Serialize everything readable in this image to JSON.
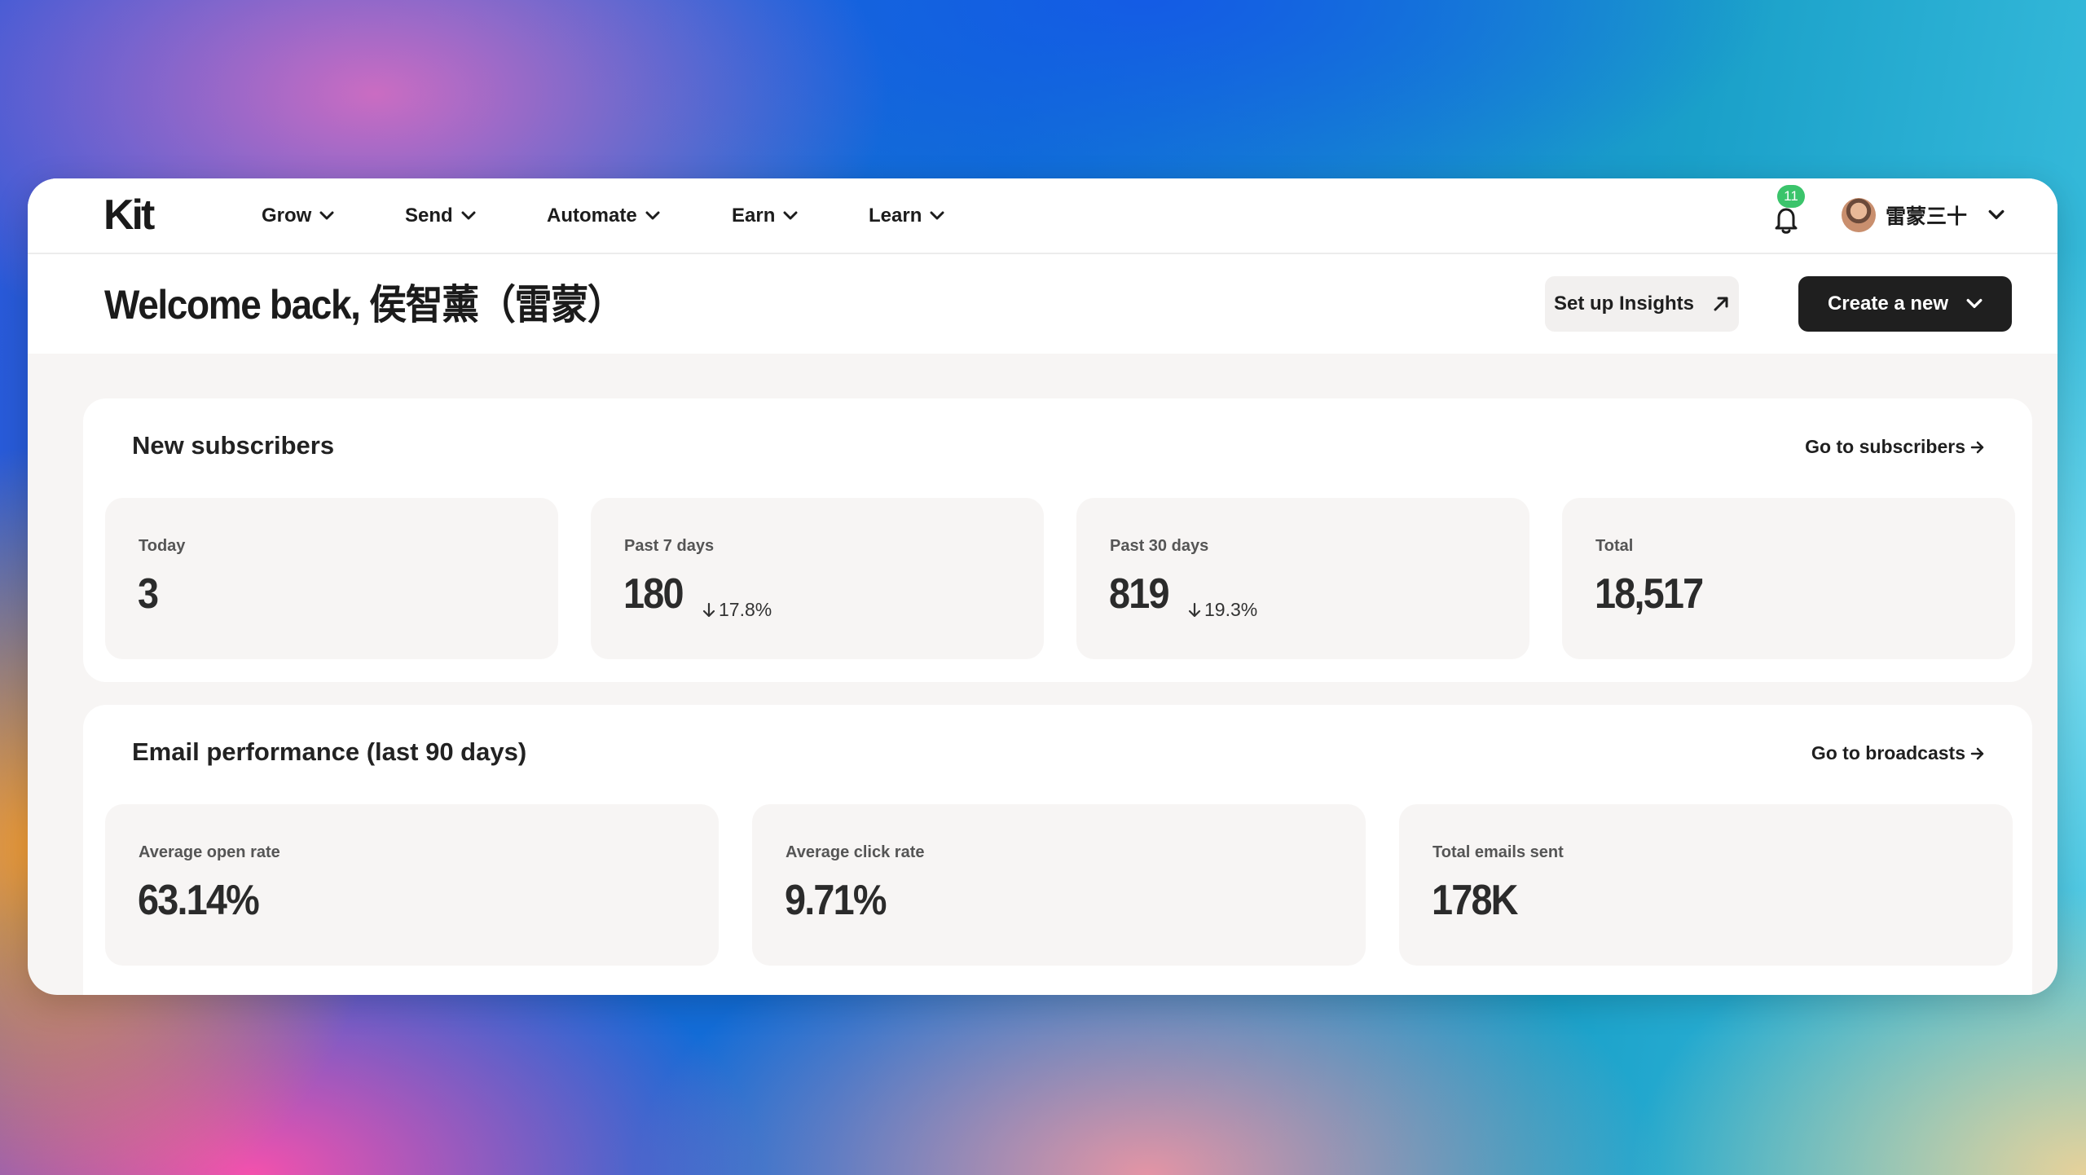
{
  "app": {
    "logo_text": "Kit"
  },
  "nav": {
    "items": [
      {
        "label": "Grow"
      },
      {
        "label": "Send"
      },
      {
        "label": "Automate"
      },
      {
        "label": "Earn"
      },
      {
        "label": "Learn"
      }
    ]
  },
  "notifications": {
    "count": "11",
    "icon": "bell-icon",
    "badge_color": "#3bc46b"
  },
  "user": {
    "name": "雷蒙三十",
    "icon": "chevron-down-icon"
  },
  "header": {
    "title": "Welcome back, 侯智薰（雷蒙）",
    "insights_button": "Set up Insights",
    "create_button": "Create a new"
  },
  "subscribers": {
    "title": "New subscribers",
    "link": "Go to subscribers",
    "stats": [
      {
        "label": "Today",
        "value": "3",
        "change": ""
      },
      {
        "label": "Past 7 days",
        "value": "180",
        "change": "17.8%"
      },
      {
        "label": "Past 30 days",
        "value": "819",
        "change": "19.3%"
      },
      {
        "label": "Total",
        "value": "18,517",
        "change": ""
      }
    ]
  },
  "email": {
    "title": "Email performance (last 90 days)",
    "link": "Go to broadcasts",
    "stats": [
      {
        "label": "Average open rate",
        "value": "63.14%"
      },
      {
        "label": "Average click rate",
        "value": "9.71%"
      },
      {
        "label": "Total emails sent",
        "value": "178K"
      }
    ]
  },
  "colors": {
    "primary_button": "#1f1f1f",
    "page_bg": "#f7f5f4",
    "card_bg": "#ffffff"
  }
}
